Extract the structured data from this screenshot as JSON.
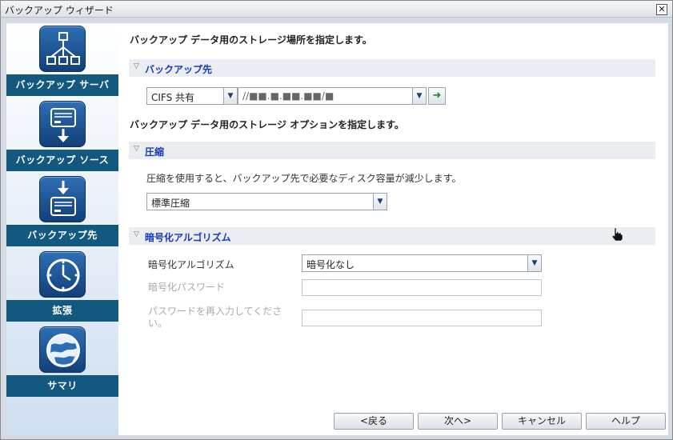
{
  "window": {
    "title": "バックアップ ウィザード",
    "close_glyph": "✕"
  },
  "sidebar": {
    "items": [
      {
        "label": "バックアップ サーバ",
        "icon": "network-server-icon"
      },
      {
        "label": "バックアップ ソース",
        "icon": "disk-source-icon"
      },
      {
        "label": "バックアップ先",
        "icon": "disk-destination-icon"
      },
      {
        "label": "拡張",
        "icon": "clock-icon"
      },
      {
        "label": "サマリ",
        "icon": "globe-icon"
      }
    ],
    "active_index": 2
  },
  "main": {
    "heading_storage": "バックアップ データ用のストレージ場所を指定します。",
    "destination": {
      "section_title": "バックアップ先",
      "type_value": "CIFS 共有",
      "path_value": "//■■.■.■■.■■/■",
      "go_glyph": "➜"
    },
    "heading_options": "バックアップ データ用のストレージ オプションを指定します。",
    "compression": {
      "section_title": "圧縮",
      "description": "圧縮を使用すると、バックアップ先で必要なディスク容量が減少します。",
      "value": "標準圧縮"
    },
    "encryption": {
      "section_title": "暗号化アルゴリズム",
      "algorithm_label": "暗号化アルゴリズム",
      "algorithm_value": "暗号化なし",
      "password_label": "暗号化パスワード",
      "reenter_label_line1": "パスワードを再入力してくださ",
      "reenter_label_line2": "い。"
    }
  },
  "footer": {
    "back_label": "<戻る",
    "next_label": "次へ>",
    "cancel_label": "キャンセル",
    "help_label": "ヘルプ"
  },
  "colors": {
    "section_title": "#1a3bb8",
    "sidebar_label_bg": "#13597f",
    "icon_bg": "#1f5ea3"
  }
}
